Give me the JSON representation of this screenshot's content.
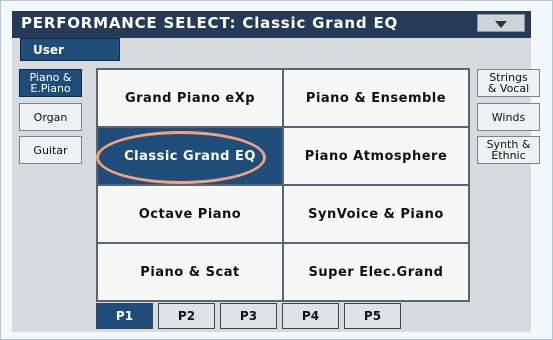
{
  "title": "PERFORMANCE SELECT: Classic Grand EQ",
  "menu_icon": "dropdown-triangle-icon",
  "user_tab": "User",
  "left_categories": [
    {
      "label": "Piano &\nE.Piano",
      "active": true
    },
    {
      "label": "Organ",
      "active": false
    },
    {
      "label": "Guitar",
      "active": false
    }
  ],
  "right_categories": [
    {
      "label": "Strings\n& Vocal"
    },
    {
      "label": "Winds"
    },
    {
      "label": "Synth &\nEthnic"
    }
  ],
  "performances": [
    "Grand Piano eXp",
    "Piano & Ensemble",
    "Classic Grand EQ",
    "Piano Atmosphere",
    "Octave Piano",
    "SynVoice & Piano",
    "Piano & Scat",
    "Super Elec.Grand"
  ],
  "selected_performance": "Classic Grand EQ",
  "pages": [
    "P1",
    "P2",
    "P3",
    "P4",
    "P5"
  ],
  "active_page": "P1",
  "colors": {
    "accent": "#1e4d7a",
    "titlebar": "#253a56",
    "highlight": "#f4a27e"
  }
}
